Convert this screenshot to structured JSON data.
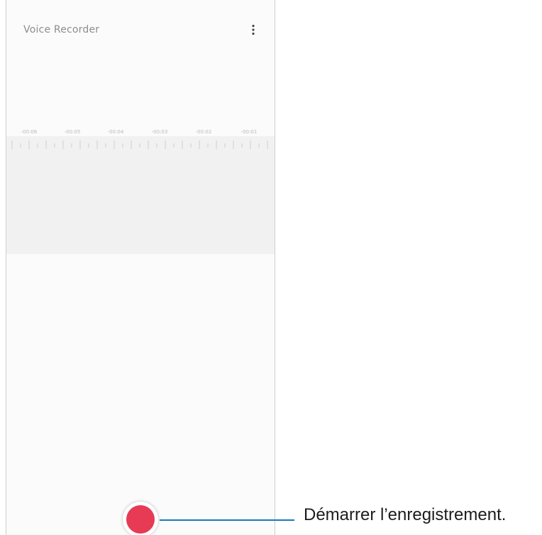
{
  "app": {
    "title": "Voice Recorder",
    "more_icon": "more-vertical-icon"
  },
  "timeline": {
    "labels": [
      "-00:06",
      "-00:05",
      "-00:04",
      "-00:03",
      "-00:02",
      "-00:01"
    ]
  },
  "record": {
    "icon": "record-icon",
    "color": "#e63a55"
  },
  "callout": {
    "text": "Démarrer l’enregistrement.",
    "line_color": "#1a7ab8"
  }
}
